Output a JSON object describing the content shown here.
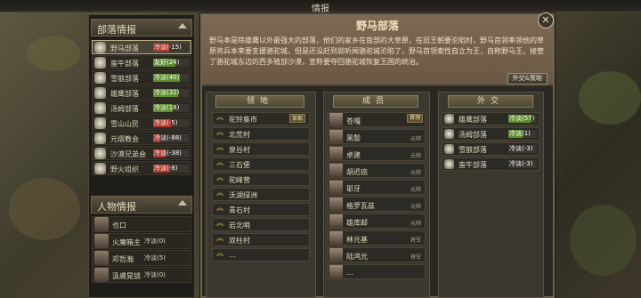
{
  "window": {
    "title": "情报"
  },
  "left_panel": {
    "faction_header": "部落情报",
    "factions": [
      {
        "name": "野马部落",
        "relation": "冷淡(-15)",
        "color": "#b03a2e",
        "fill": 0.45,
        "selected": true
      },
      {
        "name": "蛮牛部落",
        "relation": "友好(24)",
        "color": "#5f8f2e",
        "fill": 0.62
      },
      {
        "name": "雪狼部落",
        "relation": "冷淡(40)",
        "color": "#5f8f2e",
        "fill": 0.75
      },
      {
        "name": "雄鹰部落",
        "relation": "冷淡(32)",
        "color": "#5f8f2e",
        "fill": 0.7
      },
      {
        "name": "汤姆部落",
        "relation": "冷淡(18)",
        "color": "#5f8f2e",
        "fill": 0.55
      },
      {
        "name": "雪山山民",
        "relation": "冷淡(-5)",
        "color": "#b03a2e",
        "fill": 0.5
      },
      {
        "name": "元熠教会",
        "relation": "冷淡(-88)",
        "color": "#b03a2e",
        "fill": 0.2
      },
      {
        "name": "沙漠兄弟会",
        "relation": "冷淡(-38)",
        "color": "#b03a2e",
        "fill": 0.35
      },
      {
        "name": "野火组织",
        "relation": "冷淡(-8)",
        "color": "#b03a2e",
        "fill": 0.48
      }
    ],
    "person_header": "人物情报",
    "persons": [
      {
        "name": "也口",
        "status": ""
      },
      {
        "name": "火魔箱主",
        "status": "冷淡(0)"
      },
      {
        "name": "邓哲瀚",
        "status": "冷淡(5)"
      },
      {
        "name": "汲膚晃锁",
        "status": "冷淡(0)"
      }
    ]
  },
  "dialog": {
    "title": "野马部落",
    "description": "野马本是除雄鹰以外最强大的部落，他们的家乡在南部的大草原，在旧王朝要沦陷时，野马首领率领他的草原将兵本来要支援骆驼城，但是还没赶到就听闻骆驼城沦陷了，野马首领索性自立为王，自称野马王，接管了骆驼城东边的西多殖部沙漠，宣称要夺回骆驼城恢复王国的统治。",
    "diplomacy_button": "外交&策略",
    "close": "✕",
    "territory": {
      "header": "领地",
      "items": [
        {
          "name": "驼铃集市",
          "tag": "首都"
        },
        {
          "name": "北荒村"
        },
        {
          "name": "泉谷村"
        },
        {
          "name": "三石堡"
        },
        {
          "name": "驼峰营"
        },
        {
          "name": "沃湖绿洲"
        },
        {
          "name": "青石村"
        },
        {
          "name": "岩北哨"
        },
        {
          "name": "双柱村"
        },
        {
          "name": "…"
        }
      ]
    },
    "members": {
      "header": "成员",
      "items": [
        {
          "name": "苍嘎",
          "role": "首领",
          "tag": true
        },
        {
          "name": "黑鬃",
          "role": "元帅"
        },
        {
          "name": "卓建",
          "role": "元帅"
        },
        {
          "name": "胡迟癌",
          "role": "元帅"
        },
        {
          "name": "耶牙",
          "role": "元帅"
        },
        {
          "name": "格罗瓦兹",
          "role": "元帅"
        },
        {
          "name": "雄库邮",
          "role": "元帅"
        },
        {
          "name": "林元基",
          "role": "将军"
        },
        {
          "name": "陆鸿光",
          "role": "将军"
        },
        {
          "name": "…",
          "role": ""
        }
      ]
    },
    "diplomacy": {
      "header": "外交",
      "items": [
        {
          "name": "雄鹰部落",
          "relation": "冷淡(57)",
          "color": "#5f8f2e",
          "fill": 0.8
        },
        {
          "name": "汤姆部落",
          "relation": "冷淡(1)",
          "color": "#5f8f2e",
          "fill": 0.5
        },
        {
          "name": "雪狼部落",
          "relation": "冷淡(-3)",
          "color": "#4a4a40",
          "fill": 0.0
        },
        {
          "name": "蛮牛部落",
          "relation": "冷淡(-3)",
          "color": "#4a4a40",
          "fill": 0.0
        }
      ]
    }
  }
}
